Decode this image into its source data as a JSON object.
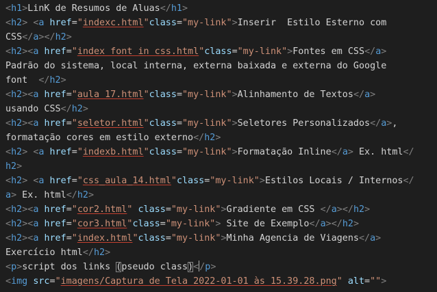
{
  "colors": {
    "background": "#1e1e1e",
    "tag": "#569cd6",
    "attribute": "#9cdcfe",
    "string": "#ce9178",
    "punctuation": "#808080",
    "text": "#d4d4d4"
  },
  "lines": [
    [
      [
        "punc",
        "<"
      ],
      [
        "tag",
        "h1"
      ],
      [
        "punc",
        ">"
      ],
      [
        "text",
        "LinK de Resumos de Aluas"
      ],
      [
        "punc",
        "</"
      ],
      [
        "tag",
        "h1"
      ],
      [
        "punc",
        ">"
      ]
    ],
    [
      [
        "punc",
        "<"
      ],
      [
        "tag",
        "h2"
      ],
      [
        "punc",
        ">"
      ],
      [
        "text",
        " "
      ],
      [
        "punc",
        "<"
      ],
      [
        "tag",
        "a"
      ],
      [
        "text",
        " "
      ],
      [
        "attr",
        "href"
      ],
      [
        "eq",
        "="
      ],
      [
        "str",
        "\""
      ],
      [
        "url",
        "indexc.html"
      ],
      [
        "str",
        "\""
      ],
      [
        "attr",
        "class"
      ],
      [
        "eq",
        "="
      ],
      [
        "str",
        "\"my-link\""
      ],
      [
        "punc",
        ">"
      ],
      [
        "text",
        "Inserir  Estilo Esterno com"
      ]
    ],
    [
      [
        "text",
        "CSS"
      ],
      [
        "punc",
        "</"
      ],
      [
        "tag",
        "a"
      ],
      [
        "punc",
        ">"
      ],
      [
        "punc",
        "</"
      ],
      [
        "tag",
        "h2"
      ],
      [
        "punc",
        ">"
      ]
    ],
    [
      [
        "punc",
        "<"
      ],
      [
        "tag",
        "h2"
      ],
      [
        "punc",
        ">"
      ],
      [
        "punc",
        "<"
      ],
      [
        "tag",
        "a"
      ],
      [
        "text",
        " "
      ],
      [
        "attr",
        "href"
      ],
      [
        "eq",
        "="
      ],
      [
        "str",
        "\""
      ],
      [
        "url",
        "index font in css.html"
      ],
      [
        "str",
        "\""
      ],
      [
        "attr",
        "class"
      ],
      [
        "eq",
        "="
      ],
      [
        "str",
        "\"my-link\""
      ],
      [
        "punc",
        ">"
      ],
      [
        "text",
        "Fontes em CSS"
      ],
      [
        "punc",
        "</"
      ],
      [
        "tag",
        "a"
      ],
      [
        "punc",
        ">"
      ]
    ],
    [
      [
        "text",
        "Padrão do sistema, local interna, externa baixada e externa do Google"
      ]
    ],
    [
      [
        "text",
        "font  "
      ],
      [
        "punc",
        "</"
      ],
      [
        "tag",
        "h2"
      ],
      [
        "punc",
        ">"
      ]
    ],
    [
      [
        "punc",
        "<"
      ],
      [
        "tag",
        "h2"
      ],
      [
        "punc",
        ">"
      ],
      [
        "punc",
        "<"
      ],
      [
        "tag",
        "a"
      ],
      [
        "text",
        " "
      ],
      [
        "attr",
        "href"
      ],
      [
        "eq",
        "="
      ],
      [
        "str",
        "\""
      ],
      [
        "url",
        "aula 17.html"
      ],
      [
        "str",
        "\""
      ],
      [
        "attr",
        "class"
      ],
      [
        "eq",
        "="
      ],
      [
        "str",
        "\"my-link\""
      ],
      [
        "punc",
        ">"
      ],
      [
        "text",
        "Alinhamento de Textos"
      ],
      [
        "punc",
        "</"
      ],
      [
        "tag",
        "a"
      ],
      [
        "punc",
        ">"
      ]
    ],
    [
      [
        "text",
        "usando CSS"
      ],
      [
        "punc",
        "</"
      ],
      [
        "tag",
        "h2"
      ],
      [
        "punc",
        ">"
      ]
    ],
    [
      [
        "punc",
        "<"
      ],
      [
        "tag",
        "h2"
      ],
      [
        "punc",
        ">"
      ],
      [
        "punc",
        "<"
      ],
      [
        "tag",
        "a"
      ],
      [
        "text",
        " "
      ],
      [
        "attr",
        "href"
      ],
      [
        "eq",
        "="
      ],
      [
        "str",
        "\""
      ],
      [
        "url",
        "seletor.html"
      ],
      [
        "str",
        "\""
      ],
      [
        "attr",
        "class"
      ],
      [
        "eq",
        "="
      ],
      [
        "str",
        "\"my-link\""
      ],
      [
        "punc",
        ">"
      ],
      [
        "text",
        "Seletores Personalizados"
      ],
      [
        "punc",
        "</"
      ],
      [
        "tag",
        "a"
      ],
      [
        "punc",
        ">"
      ],
      [
        "text",
        ","
      ]
    ],
    [
      [
        "text",
        "formatação cores em estilo externo"
      ],
      [
        "punc",
        "</"
      ],
      [
        "tag",
        "h2"
      ],
      [
        "punc",
        ">"
      ]
    ],
    [
      [
        "punc",
        "<"
      ],
      [
        "tag",
        "h2"
      ],
      [
        "punc",
        ">"
      ],
      [
        "text",
        " "
      ],
      [
        "punc",
        "<"
      ],
      [
        "tag",
        "a"
      ],
      [
        "text",
        " "
      ],
      [
        "attr",
        "href"
      ],
      [
        "eq",
        "="
      ],
      [
        "str",
        "\""
      ],
      [
        "url",
        "indexb.html"
      ],
      [
        "str",
        "\""
      ],
      [
        "attr",
        "class"
      ],
      [
        "eq",
        "="
      ],
      [
        "str",
        "\"my-link\""
      ],
      [
        "punc",
        ">"
      ],
      [
        "text",
        "Formatação Inline"
      ],
      [
        "punc",
        "</"
      ],
      [
        "tag",
        "a"
      ],
      [
        "punc",
        ">"
      ],
      [
        "text",
        " Ex. html"
      ],
      [
        "punc",
        "</"
      ]
    ],
    [
      [
        "tag",
        "h2"
      ],
      [
        "punc",
        ">"
      ]
    ],
    [
      [
        "punc",
        "<"
      ],
      [
        "tag",
        "h2"
      ],
      [
        "punc",
        ">"
      ],
      [
        "text",
        " "
      ],
      [
        "punc",
        "<"
      ],
      [
        "tag",
        "a"
      ],
      [
        "text",
        " "
      ],
      [
        "attr",
        "href"
      ],
      [
        "eq",
        "="
      ],
      [
        "str",
        "\""
      ],
      [
        "url",
        "css_aula_14.html"
      ],
      [
        "str",
        "\""
      ],
      [
        "attr",
        "class"
      ],
      [
        "eq",
        "="
      ],
      [
        "str",
        "\"my-link\""
      ],
      [
        "punc",
        ">"
      ],
      [
        "text",
        "Estilos Locais / Internos"
      ],
      [
        "punc",
        "</"
      ]
    ],
    [
      [
        "tag",
        "a"
      ],
      [
        "punc",
        ">"
      ],
      [
        "text",
        " Ex. html"
      ],
      [
        "punc",
        "</"
      ],
      [
        "tag",
        "h2"
      ],
      [
        "punc",
        ">"
      ]
    ],
    [
      [
        "punc",
        "<"
      ],
      [
        "tag",
        "h2"
      ],
      [
        "punc",
        ">"
      ],
      [
        "punc",
        "<"
      ],
      [
        "tag",
        "a"
      ],
      [
        "text",
        " "
      ],
      [
        "attr",
        "href"
      ],
      [
        "eq",
        "="
      ],
      [
        "str",
        "\""
      ],
      [
        "url",
        "cor2.html"
      ],
      [
        "str",
        "\""
      ],
      [
        "text",
        " "
      ],
      [
        "attr",
        "class"
      ],
      [
        "eq",
        "="
      ],
      [
        "str",
        "\"my-link\""
      ],
      [
        "punc",
        ">"
      ],
      [
        "text",
        "Gradiente em CSS "
      ],
      [
        "punc",
        "</"
      ],
      [
        "tag",
        "a"
      ],
      [
        "punc",
        ">"
      ],
      [
        "punc",
        "</"
      ],
      [
        "tag",
        "h2"
      ],
      [
        "punc",
        ">"
      ]
    ],
    [
      [
        "punc",
        "<"
      ],
      [
        "tag",
        "h2"
      ],
      [
        "punc",
        ">"
      ],
      [
        "punc",
        "<"
      ],
      [
        "tag",
        "a"
      ],
      [
        "text",
        " "
      ],
      [
        "attr",
        "href"
      ],
      [
        "eq",
        "="
      ],
      [
        "str",
        "\""
      ],
      [
        "url",
        "cor3.html"
      ],
      [
        "str",
        "\""
      ],
      [
        "attr",
        "class"
      ],
      [
        "eq",
        "="
      ],
      [
        "str",
        "\"my-link\""
      ],
      [
        "punc",
        ">"
      ],
      [
        "text",
        " Site de Exemplo"
      ],
      [
        "punc",
        "</"
      ],
      [
        "tag",
        "a"
      ],
      [
        "punc",
        ">"
      ],
      [
        "punc",
        "</"
      ],
      [
        "tag",
        "h2"
      ],
      [
        "punc",
        ">"
      ]
    ],
    [
      [
        "punc",
        "<"
      ],
      [
        "tag",
        "h2"
      ],
      [
        "punc",
        ">"
      ],
      [
        "punc",
        "<"
      ],
      [
        "tag",
        "a"
      ],
      [
        "text",
        " "
      ],
      [
        "attr",
        "href"
      ],
      [
        "eq",
        "="
      ],
      [
        "str",
        "\""
      ],
      [
        "url",
        "index.html"
      ],
      [
        "str",
        "\""
      ],
      [
        "attr",
        "class"
      ],
      [
        "eq",
        "="
      ],
      [
        "str",
        "\"my-link\""
      ],
      [
        "punc",
        ">"
      ],
      [
        "text",
        "Minha Agencia de Viagens"
      ],
      [
        "punc",
        "</"
      ],
      [
        "tag",
        "a"
      ],
      [
        "punc",
        ">"
      ]
    ],
    [
      [
        "text",
        "Exercício html"
      ],
      [
        "punc",
        "</"
      ],
      [
        "tag",
        "h2"
      ],
      [
        "punc",
        ">"
      ]
    ],
    [
      [
        "punc",
        "<"
      ],
      [
        "tag",
        "p"
      ],
      [
        "punc",
        ">"
      ],
      [
        "text",
        "script dos links "
      ],
      [
        "hl",
        "("
      ],
      [
        "text",
        "pseudo class"
      ],
      [
        "hl",
        ")"
      ],
      [
        "punc",
        "<"
      ],
      [
        "cursor",
        ""
      ],
      [
        "punc",
        "/"
      ],
      [
        "tag",
        "p"
      ],
      [
        "punc",
        ">"
      ]
    ],
    [
      [
        "punc",
        "<"
      ],
      [
        "tag",
        "img"
      ],
      [
        "text",
        " "
      ],
      [
        "attr",
        "src"
      ],
      [
        "eq",
        "="
      ],
      [
        "str",
        "\""
      ],
      [
        "url",
        "imagens/Captura de Tela 2022-01-01 às 15.39.28.png"
      ],
      [
        "str",
        "\""
      ],
      [
        "text",
        " "
      ],
      [
        "attr",
        "alt"
      ],
      [
        "eq",
        "="
      ],
      [
        "str",
        "\"\""
      ],
      [
        "punc",
        ">"
      ]
    ]
  ]
}
